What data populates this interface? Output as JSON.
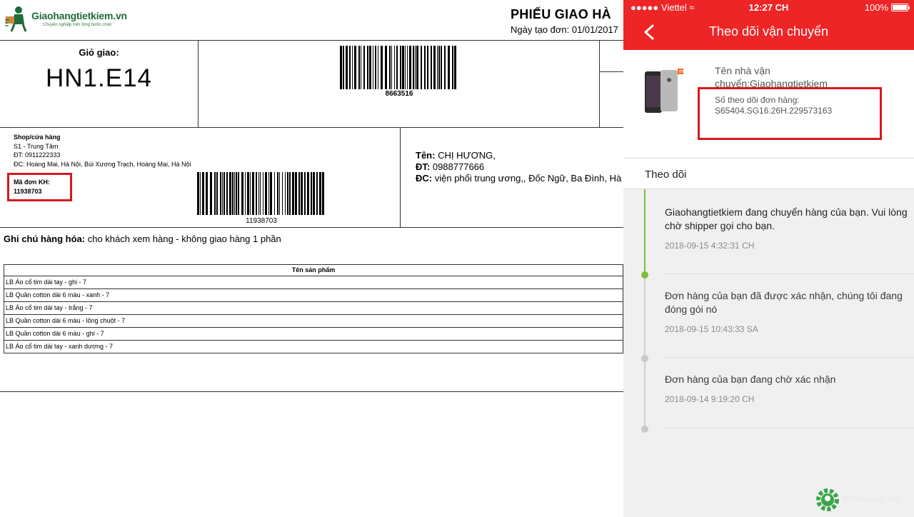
{
  "slip": {
    "logo_name": "Giaohangtietkiem.vn",
    "logo_tagline": "Chuyên nghiệp trên từng bước chân",
    "title": "PHIẾU GIAO HÀ",
    "date_text": "Ngày tạo đơn: 01/01/2017",
    "zone_label": "Giỏ giao:",
    "zone_code": "HN1.E14",
    "barcode_top_number": "8663516",
    "shop": {
      "heading": "Shop/cửa hàng",
      "name": "S1 - Trung Tâm",
      "phone": "ĐT: 0911222333",
      "address": "ĐC: Hoàng Mai, Hà Nội, Bùi Xương Trạch, Hoàng Mai, Hà Nội"
    },
    "order_kh_label": "Mã đơn KH:",
    "order_kh_value": "11938703",
    "barcode_bottom_number": "11938703",
    "recipient": {
      "name_label": "Tên:",
      "name_value": "CHỊ HƯƠNG,",
      "phone_label": "ĐT:",
      "phone_value": "0988777666",
      "address_label": "ĐC:",
      "address_value": "viện phổi trung ương,, Đốc Ngữ, Ba Đình, Hà"
    },
    "note_label": "Ghi chú hàng hóa:",
    "note_value": "cho khách xem hàng - không giao hàng 1 phần",
    "products_header": "Tên sản phẩm",
    "products": [
      "LB Áo cổ tim dài tay - ghi - 7",
      "LB Quần cotton dài 6 màu - xanh - 7",
      "LB Áo cổ tim dài tay - trắng - 7",
      "LB Quần cotton dài 6 màu - lông chuột - 7",
      "LB Quần cotton dài 6 màu - ghi - 7",
      "LB Áo cổ tim dài tay - xanh dương - 7"
    ]
  },
  "phone": {
    "carrier": "Viettel",
    "time": "12:27 CH",
    "battery": "100%",
    "battery_level": 1.0,
    "title": "Theo dõi vận chuyển",
    "carrier_label": "Tên nhà vận chuyển:Giaohangtietkiem",
    "tracking_label": "Số theo dõi đơn hàng:",
    "tracking_value": "S65404.SG16.26H.229573163",
    "follow_label": "Theo dõi",
    "events": [
      {
        "text": "Giaohangtietkiem đang chuyển hàng của bạn. Vui lòng chờ shipper gọi cho bạn.",
        "time": "2018-09-15 4:32:31 CH",
        "active": true
      },
      {
        "text": "Đơn hàng của bạn đã được xác nhận, chúng tôi đang đóng gói nó",
        "time": "2018-09-15 10:43:33 SA",
        "active": false
      },
      {
        "text": "Đơn hàng của bạn đang chờ xác nhận",
        "time": "2018-09-14 9:19:20 CH",
        "active": false
      }
    ],
    "watermark": "TOTHUIKC.VN"
  },
  "colors": {
    "header_red": "#ee2527",
    "highlight_red": "#d8181d",
    "timeline_green": "#7bbf3a",
    "logo_green": "#1f6b3a"
  }
}
